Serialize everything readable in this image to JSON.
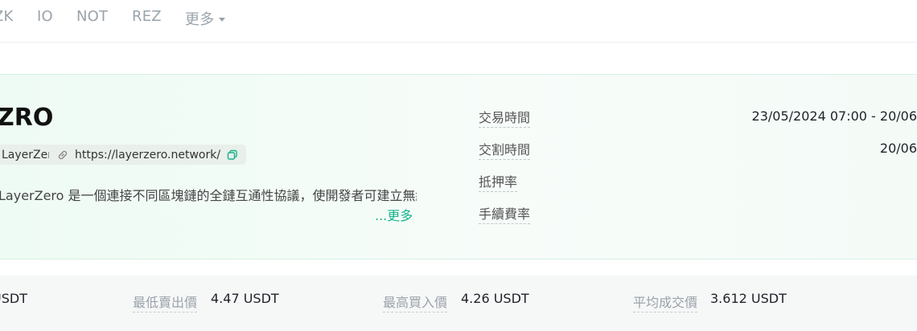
{
  "nav": {
    "tabs": [
      "ZK",
      "IO",
      "NOT",
      "REZ"
    ],
    "more_label": "更多"
  },
  "project": {
    "title": "ZRO",
    "name_chip": "LayerZero",
    "website": "https://layerzero.network/",
    "description": "LayerZero 是一個連接不同區塊鏈的全鏈互通性協議，使開發者可建立無縫的全鏈應用程",
    "more_label": "...更多"
  },
  "details": {
    "trade_time_label": "交易時間",
    "trade_time_value": "23/05/2024 07:00 - 20/06",
    "delivery_time_label": "交割時間",
    "delivery_time_value": "20/06",
    "collateral_label": "抵押率",
    "fee_label": "手續費率"
  },
  "stats": {
    "first_value": "USDT",
    "lowest_sell_label": "最低賣出價",
    "lowest_sell_value": "4.47 USDT",
    "highest_buy_label": "最高買入價",
    "highest_buy_value": "4.26 USDT",
    "avg_price_label": "平均成交價",
    "avg_price_value": "3.612 USDT"
  },
  "colors": {
    "accent": "#15b38a",
    "panel_bg": "#eefbf4",
    "muted_text": "#9aa3ab"
  }
}
